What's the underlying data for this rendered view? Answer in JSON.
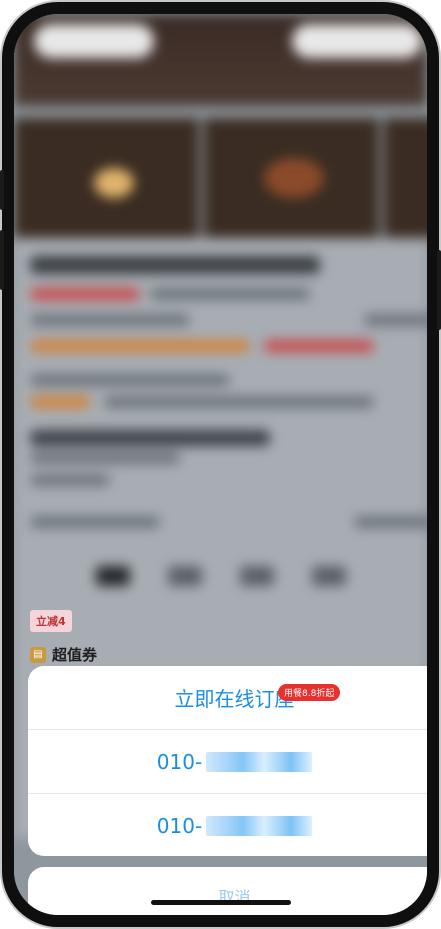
{
  "background": {
    "section_title": "超值券",
    "promo_tag": "立减4",
    "tabs": [
      "",
      "",
      "",
      ""
    ]
  },
  "action_sheet": {
    "items": [
      {
        "label": "立即在线订座",
        "badge": "用餐8.8折起"
      },
      {
        "label": "010-",
        "masked": true
      },
      {
        "label": "010-",
        "masked": true
      }
    ],
    "cancel_label": "取消"
  },
  "colors": {
    "link_blue": "#1a8ee6",
    "badge_red": "#e8302f"
  }
}
